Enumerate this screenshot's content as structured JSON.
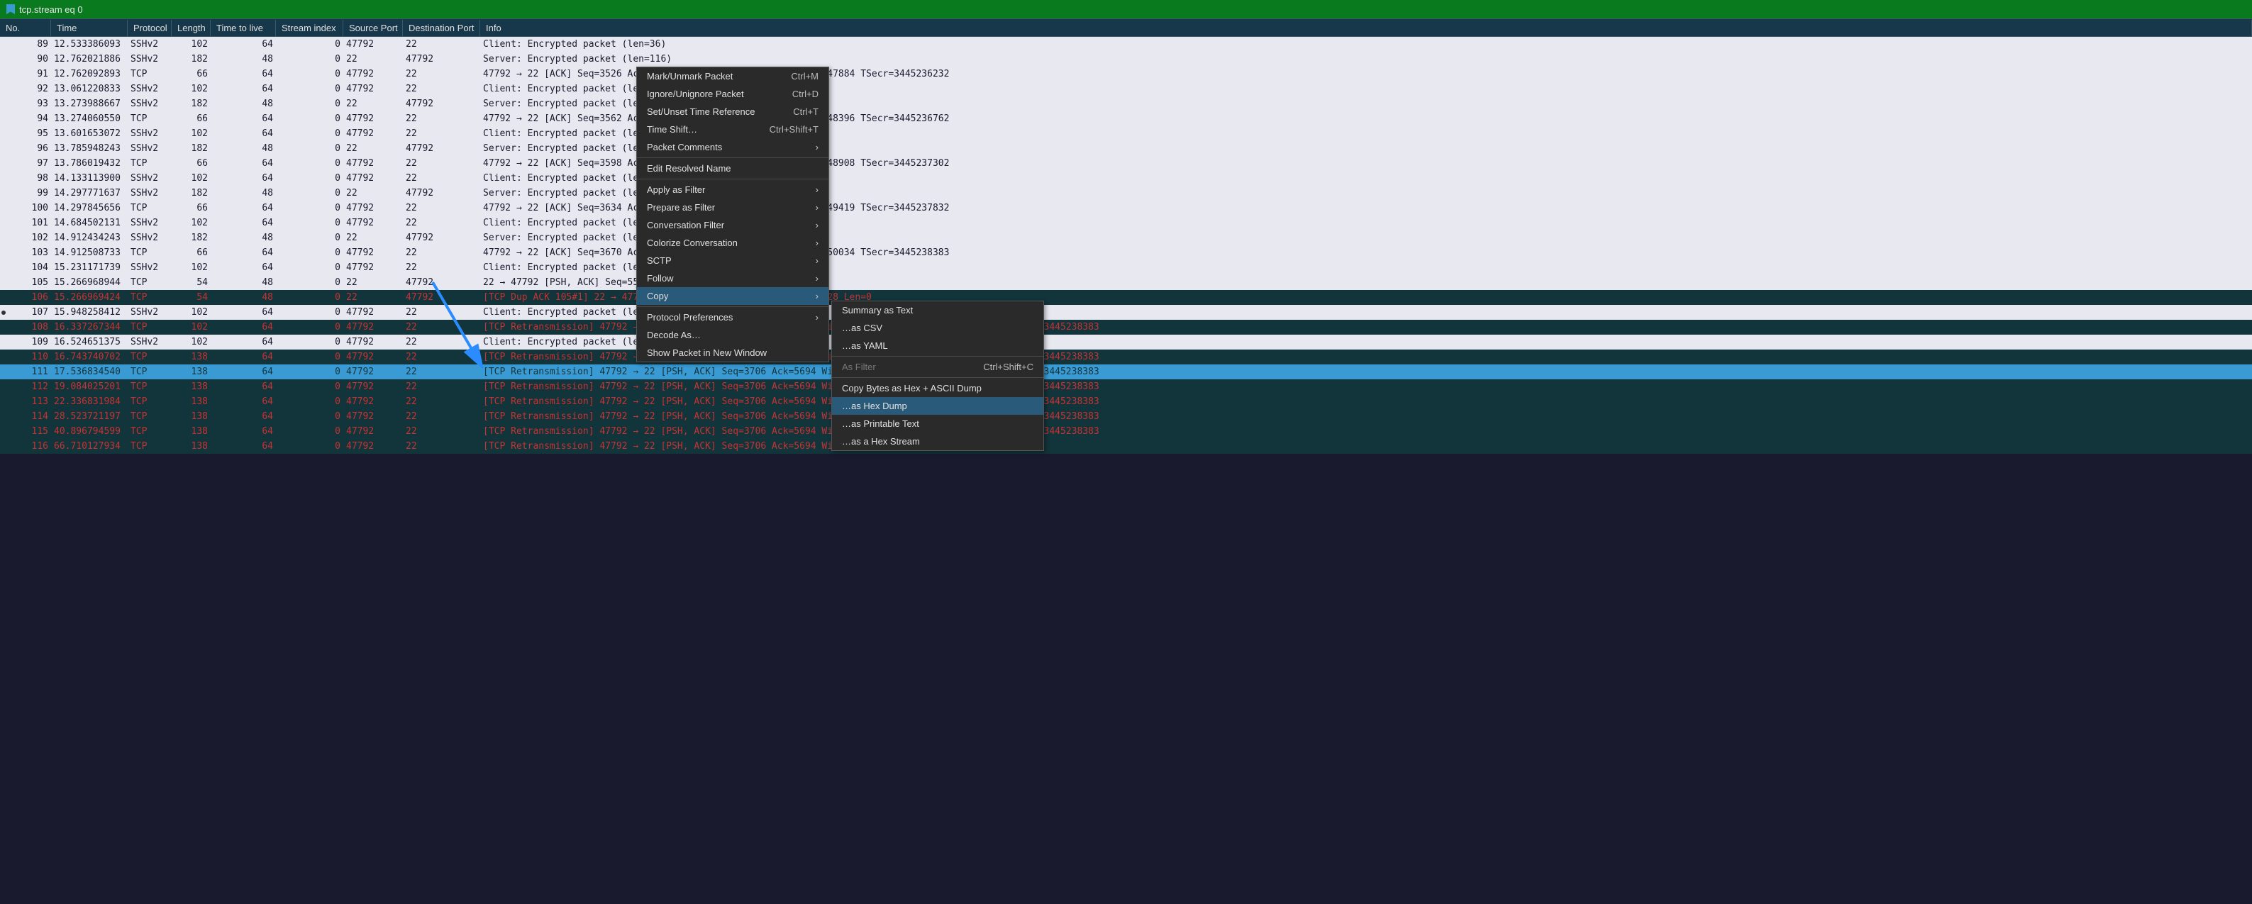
{
  "filter": {
    "text": "tcp.stream eq 0"
  },
  "columns": [
    "No.",
    "Time",
    "Protocol",
    "Length",
    "Time to live",
    "Stream index",
    "Source Port",
    "Destination Port",
    "Info"
  ],
  "packets": [
    {
      "no": "89",
      "time": "12.533386093",
      "proto": "SSHv2",
      "len": "102",
      "ttl": "64",
      "stream": "0",
      "sport": "47792",
      "dport": "22",
      "info": "Client: Encrypted packet (len=36)",
      "cls": "normal"
    },
    {
      "no": "90",
      "time": "12.762021886",
      "proto": "SSHv2",
      "len": "182",
      "ttl": "48",
      "stream": "0",
      "sport": "22",
      "dport": "47792",
      "info": "Server: Encrypted packet (len=116)",
      "cls": "normal"
    },
    {
      "no": "91",
      "time": "12.762092893",
      "proto": "TCP",
      "len": "66",
      "ttl": "64",
      "stream": "0",
      "sport": "47792",
      "dport": "22",
      "info": "47792 → 22 [ACK] Seq=3526 Ack=5130 Win=64128 Len=0 TSval=3445247884 TSecr=3445236232",
      "cls": "normal"
    },
    {
      "no": "92",
      "time": "13.061220833",
      "proto": "SSHv2",
      "len": "102",
      "ttl": "64",
      "stream": "0",
      "sport": "47792",
      "dport": "22",
      "info": "Client: Encrypted packet (len=36)",
      "cls": "normal"
    },
    {
      "no": "93",
      "time": "13.273988667",
      "proto": "SSHv2",
      "len": "182",
      "ttl": "48",
      "stream": "0",
      "sport": "22",
      "dport": "47792",
      "info": "Server: Encrypted packet (len=116)",
      "cls": "normal"
    },
    {
      "no": "94",
      "time": "13.274060550",
      "proto": "TCP",
      "len": "66",
      "ttl": "64",
      "stream": "0",
      "sport": "47792",
      "dport": "22",
      "info": "47792 → 22 [ACK] Seq=3562 Ack=5246 Win=64128 Len=0 TSval=3445248396 TSecr=3445236762",
      "cls": "normal"
    },
    {
      "no": "95",
      "time": "13.601653072",
      "proto": "SSHv2",
      "len": "102",
      "ttl": "64",
      "stream": "0",
      "sport": "47792",
      "dport": "22",
      "info": "Client: Encrypted packet (len=36)",
      "cls": "normal"
    },
    {
      "no": "96",
      "time": "13.785948243",
      "proto": "SSHv2",
      "len": "182",
      "ttl": "48",
      "stream": "0",
      "sport": "22",
      "dport": "47792",
      "info": "Server: Encrypted packet (len=116)",
      "cls": "normal"
    },
    {
      "no": "97",
      "time": "13.786019432",
      "proto": "TCP",
      "len": "66",
      "ttl": "64",
      "stream": "0",
      "sport": "47792",
      "dport": "22",
      "info": "47792 → 22 [ACK] Seq=3598 Ack=5362 Win=64128 Len=0 TSval=3445248908 TSecr=3445237302",
      "cls": "normal"
    },
    {
      "no": "98",
      "time": "14.133113900",
      "proto": "SSHv2",
      "len": "102",
      "ttl": "64",
      "stream": "0",
      "sport": "47792",
      "dport": "22",
      "info": "Client: Encrypted packet (len=36)",
      "cls": "normal"
    },
    {
      "no": "99",
      "time": "14.297771637",
      "proto": "SSHv2",
      "len": "182",
      "ttl": "48",
      "stream": "0",
      "sport": "22",
      "dport": "47792",
      "info": "Server: Encrypted packet (len=116)",
      "cls": "normal"
    },
    {
      "no": "100",
      "time": "14.297845656",
      "proto": "TCP",
      "len": "66",
      "ttl": "64",
      "stream": "0",
      "sport": "47792",
      "dport": "22",
      "info": "47792 → 22 [ACK] Seq=3634 Ack=5478 Win=64128 Len=0 TSval=3445249419 TSecr=3445237832",
      "cls": "normal"
    },
    {
      "no": "101",
      "time": "14.684502131",
      "proto": "SSHv2",
      "len": "102",
      "ttl": "64",
      "stream": "0",
      "sport": "47792",
      "dport": "22",
      "info": "Client: Encrypted packet (len=36)",
      "cls": "normal"
    },
    {
      "no": "102",
      "time": "14.912434243",
      "proto": "SSHv2",
      "len": "182",
      "ttl": "48",
      "stream": "0",
      "sport": "22",
      "dport": "47792",
      "info": "Server: Encrypted packet (len=116)",
      "cls": "normal"
    },
    {
      "no": "103",
      "time": "14.912508733",
      "proto": "TCP",
      "len": "66",
      "ttl": "64",
      "stream": "0",
      "sport": "47792",
      "dport": "22",
      "info": "47792 → 22 [ACK] Seq=3670 Ack=5594 Win=64128 Len=0 TSval=3445250034 TSecr=3445238383",
      "cls": "normal"
    },
    {
      "no": "104",
      "time": "15.231171739",
      "proto": "SSHv2",
      "len": "102",
      "ttl": "64",
      "stream": "0",
      "sport": "47792",
      "dport": "22",
      "info": "Client: Encrypted packet (len=36)",
      "cls": "normal"
    },
    {
      "no": "105",
      "time": "15.266968944",
      "proto": "TCP",
      "len": "54",
      "ttl": "48",
      "stream": "0",
      "sport": "22",
      "dport": "47792",
      "info": "22 → 47792 [PSH, ACK] Seq=5594 Ack=3706 Win=64128 Len=0",
      "cls": "normal"
    },
    {
      "no": "106",
      "time": "15.266969424",
      "proto": "TCP",
      "len": "54",
      "ttl": "48",
      "stream": "0",
      "sport": "22",
      "dport": "47792",
      "info": "[TCP Dup ACK 105#1] 22 → 47792 [ACK] Seq=5594 Ack=3706 Win=64128 Len=0",
      "cls": "dark-retrans"
    },
    {
      "no": "107",
      "time": "15.948258412",
      "proto": "SSHv2",
      "len": "102",
      "ttl": "64",
      "stream": "0",
      "sport": "47792",
      "dport": "22",
      "info": "Client: Encrypted packet (len=36)",
      "cls": "normal",
      "marker": true
    },
    {
      "no": "108",
      "time": "16.337267344",
      "proto": "TCP",
      "len": "102",
      "ttl": "64",
      "stream": "0",
      "sport": "47792",
      "dport": "22",
      "info": "[TCP Retransmission] 47792 → 22 [PSH, ACK] Seq=3706 Ack=5694 Win=64128 Len=36 TSval=3445251459 TSecr=3445238383",
      "cls": "dark-retrans"
    },
    {
      "no": "109",
      "time": "16.524651375",
      "proto": "SSHv2",
      "len": "102",
      "ttl": "64",
      "stream": "0",
      "sport": "47792",
      "dport": "22",
      "info": "Client: Encrypted packet (len=36)",
      "cls": "normal"
    },
    {
      "no": "110",
      "time": "16.743740702",
      "proto": "TCP",
      "len": "138",
      "ttl": "64",
      "stream": "0",
      "sport": "47792",
      "dport": "22",
      "info": "[TCP Retransmission] 47792 → 22 [PSH, ACK] Seq=3706 Ack=5694 Win=64128 Len=72 TSval=3445251865 TSecr=3445238383",
      "cls": "dark-retrans"
    },
    {
      "no": "111",
      "time": "17.536834540",
      "proto": "TCP",
      "len": "138",
      "ttl": "64",
      "stream": "0",
      "sport": "47792",
      "dport": "22",
      "info": "[TCP Retransmission] 47792 → 22 [PSH, ACK] Seq=3706 Ack=5694 Win=64128 Len=72 TSval=3445252658 TSecr=3445238383",
      "cls": "selected"
    },
    {
      "no": "112",
      "time": "19.084025201",
      "proto": "TCP",
      "len": "138",
      "ttl": "64",
      "stream": "0",
      "sport": "47792",
      "dport": "22",
      "info": "[TCP Retransmission] 47792 → 22 [PSH, ACK] Seq=3706 Ack=5694 Win=64128 Len=72 TSval=3445254205 TSecr=3445238383",
      "cls": "dark-retrans"
    },
    {
      "no": "113",
      "time": "22.336831984",
      "proto": "TCP",
      "len": "138",
      "ttl": "64",
      "stream": "0",
      "sport": "47792",
      "dport": "22",
      "info": "[TCP Retransmission] 47792 → 22 [PSH, ACK] Seq=3706 Ack=5694 Win=64128 Len=72 TSval=3445257458 TSecr=3445238383",
      "cls": "dark-retrans"
    },
    {
      "no": "114",
      "time": "28.523721197",
      "proto": "TCP",
      "len": "138",
      "ttl": "64",
      "stream": "0",
      "sport": "47792",
      "dport": "22",
      "info": "[TCP Retransmission] 47792 → 22 [PSH, ACK] Seq=3706 Ack=5694 Win=64128 Len=72 TSval=3445263645 TSecr=3445238383",
      "cls": "dark-retrans"
    },
    {
      "no": "115",
      "time": "40.896794599",
      "proto": "TCP",
      "len": "138",
      "ttl": "64",
      "stream": "0",
      "sport": "47792",
      "dport": "22",
      "info": "[TCP Retransmission] 47792 → 22 [PSH, ACK] Seq=3706 Ack=5694 Win=64128 Len=72 TSval=3445276018 TSecr=3445238383",
      "cls": "dark-retrans"
    },
    {
      "no": "116",
      "time": "66.710127934",
      "proto": "TCP",
      "len": "138",
      "ttl": "64",
      "stream": "0",
      "sport": "47792",
      "dport": "22",
      "info": "[TCP Retransmission] 47792 → 22 [PSH, ACK] Seq=3706 Ack=5694 Win=64128 Len=72",
      "cls": "dark-retrans"
    }
  ],
  "menu1": {
    "items": [
      {
        "label": "Mark/Unmark Packet",
        "shortcut": "Ctrl+M"
      },
      {
        "label": "Ignore/Unignore Packet",
        "shortcut": "Ctrl+D"
      },
      {
        "label": "Set/Unset Time Reference",
        "shortcut": "Ctrl+T"
      },
      {
        "label": "Time Shift…",
        "shortcut": "Ctrl+Shift+T"
      },
      {
        "label": "Packet Comments",
        "sub": true
      },
      {
        "sep": true
      },
      {
        "label": "Edit Resolved Name"
      },
      {
        "sep": true
      },
      {
        "label": "Apply as Filter",
        "sub": true
      },
      {
        "label": "Prepare as Filter",
        "sub": true
      },
      {
        "label": "Conversation Filter",
        "sub": true
      },
      {
        "label": "Colorize Conversation",
        "sub": true
      },
      {
        "label": "SCTP",
        "sub": true
      },
      {
        "label": "Follow",
        "sub": true
      },
      {
        "label": "Copy",
        "sub": true,
        "active": true
      },
      {
        "sep": true
      },
      {
        "label": "Protocol Preferences",
        "sub": true
      },
      {
        "label": "Decode As…"
      },
      {
        "label": "Show Packet in New Window"
      }
    ]
  },
  "menu2": {
    "items": [
      {
        "label": "Summary as Text"
      },
      {
        "label": "…as CSV"
      },
      {
        "label": "…as YAML"
      },
      {
        "sep": true
      },
      {
        "label": "As Filter",
        "shortcut": "Ctrl+Shift+C",
        "disabled": true
      },
      {
        "sep": true
      },
      {
        "label": "Copy Bytes as Hex + ASCII Dump"
      },
      {
        "label": "…as Hex Dump",
        "active": true
      },
      {
        "label": "…as Printable Text"
      },
      {
        "label": "…as a Hex Stream"
      }
    ]
  }
}
